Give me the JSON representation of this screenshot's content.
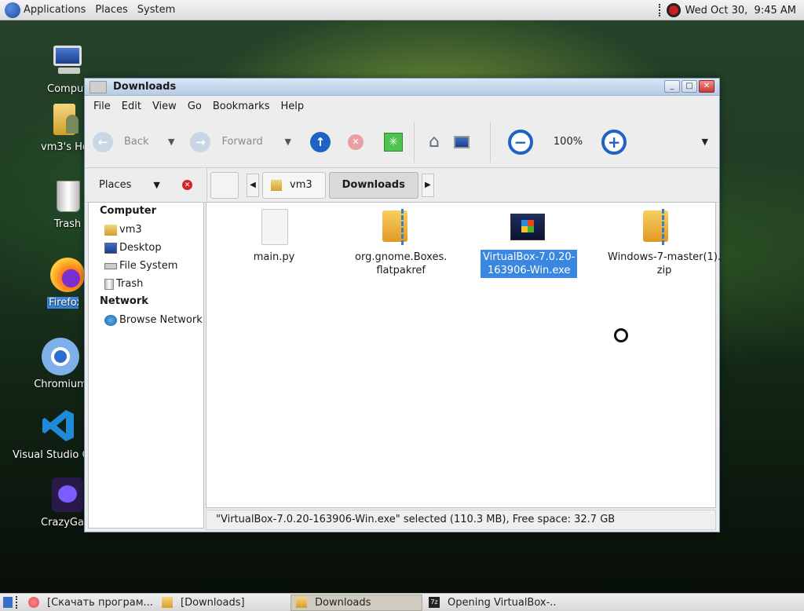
{
  "top_panel": {
    "menus": [
      "Applications",
      "Places",
      "System"
    ],
    "clock": "Wed Oct 30,  9:45 AM"
  },
  "desktop": {
    "icons": [
      "Computer",
      "vm3's Home",
      "Trash",
      "Firefox",
      "Chromium",
      "Visual Studio Code",
      "CrazyGames"
    ]
  },
  "window": {
    "title": "Downloads",
    "menu": [
      "File",
      "Edit",
      "View",
      "Go",
      "Bookmarks",
      "Help"
    ],
    "toolbar": {
      "back": "Back",
      "forward": "Forward",
      "zoom": "100%"
    },
    "places_label": "Places",
    "breadcrumb": [
      "vm3",
      "Downloads"
    ],
    "sidebar": {
      "computer_header": "Computer",
      "computer_items": [
        "vm3",
        "Desktop",
        "File System",
        "Trash"
      ],
      "network_header": "Network",
      "network_items": [
        "Browse Network"
      ]
    },
    "files": [
      {
        "name": "main.py",
        "type": "text"
      },
      {
        "name": "org.gnome.Boxes.\nflatpakref",
        "type": "archive"
      },
      {
        "name": "VirtualBox-7.0.20-\n163906-Win.exe",
        "type": "exe",
        "selected": true
      },
      {
        "name": "Windows-7-master(1).\nzip",
        "type": "archive"
      }
    ],
    "status": "\"VirtualBox-7.0.20-163906-Win.exe\" selected (110.3 MB), Free space: 32.7 GB"
  },
  "taskbar": [
    {
      "label": "[Скачать програм...",
      "active": false
    },
    {
      "label": "[Downloads]",
      "active": false
    },
    {
      "label": "Downloads",
      "active": true
    },
    {
      "label": "Opening VirtualBox-...",
      "active": false
    }
  ]
}
